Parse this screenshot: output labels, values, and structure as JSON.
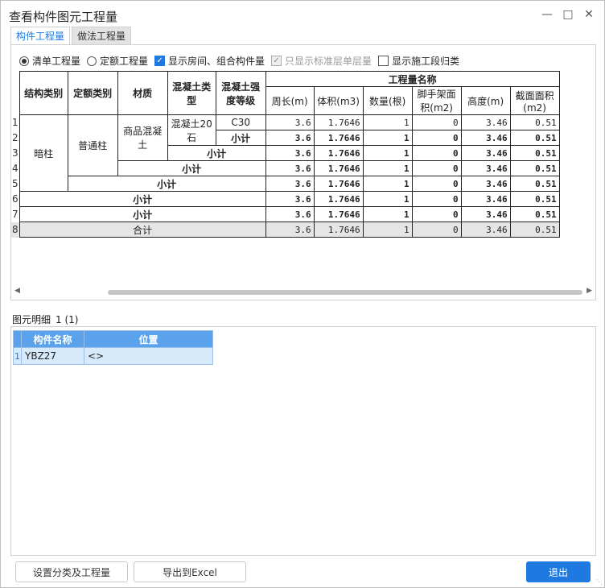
{
  "window": {
    "title": "查看构件图元工程量"
  },
  "tabs": [
    {
      "label": "构件工程量"
    },
    {
      "label": "做法工程量"
    }
  ],
  "options": {
    "radio_list": "清单工程量",
    "radio_quota": "定额工程量",
    "show_rooms": "显示房间、组合构件量",
    "std_floor_only": "只显示标准层单层量",
    "show_segments": "显示施工段归类"
  },
  "table": {
    "headers": {
      "category": "结构类别",
      "quota_category": "定额类别",
      "material": "材质",
      "concrete_type": "混凝土类型",
      "strength": "混凝土强度等级",
      "quantity_group": "工程量名称",
      "perimeter": "周长(m)",
      "volume": "体积(m3)",
      "count": "数量(根)",
      "scaffold": "脚手架面积(m2)",
      "height": "高度(m)",
      "section": "截面面积(m2)"
    },
    "row_numbers": [
      "1",
      "2",
      "3",
      "4",
      "5",
      "6",
      "7",
      "8"
    ],
    "cells": {
      "category": "暗柱",
      "quota_category": "普通柱",
      "material": "商品混凝土",
      "concrete_type": "混凝土20石",
      "strength": "C30",
      "subtotal": "小计",
      "total": "合计"
    },
    "values": {
      "perimeter": "3.6",
      "volume": "1.7646",
      "count": "1",
      "scaffold": "0",
      "height": "3.46",
      "section": "0.51"
    }
  },
  "detail": {
    "label": "图元明细",
    "count": "1 (1)",
    "headers": {
      "name": "构件名称",
      "position": "位置"
    },
    "rows": [
      {
        "num": "1",
        "name": "YBZ27",
        "position": "<>"
      }
    ]
  },
  "buttons": {
    "settings": "设置分类及工程量",
    "export": "导出到Excel",
    "exit": "退出"
  },
  "colors": {
    "accent": "#1e7ae0",
    "header_blue": "#5aa3ec",
    "total_row": "#e5e5e5"
  }
}
